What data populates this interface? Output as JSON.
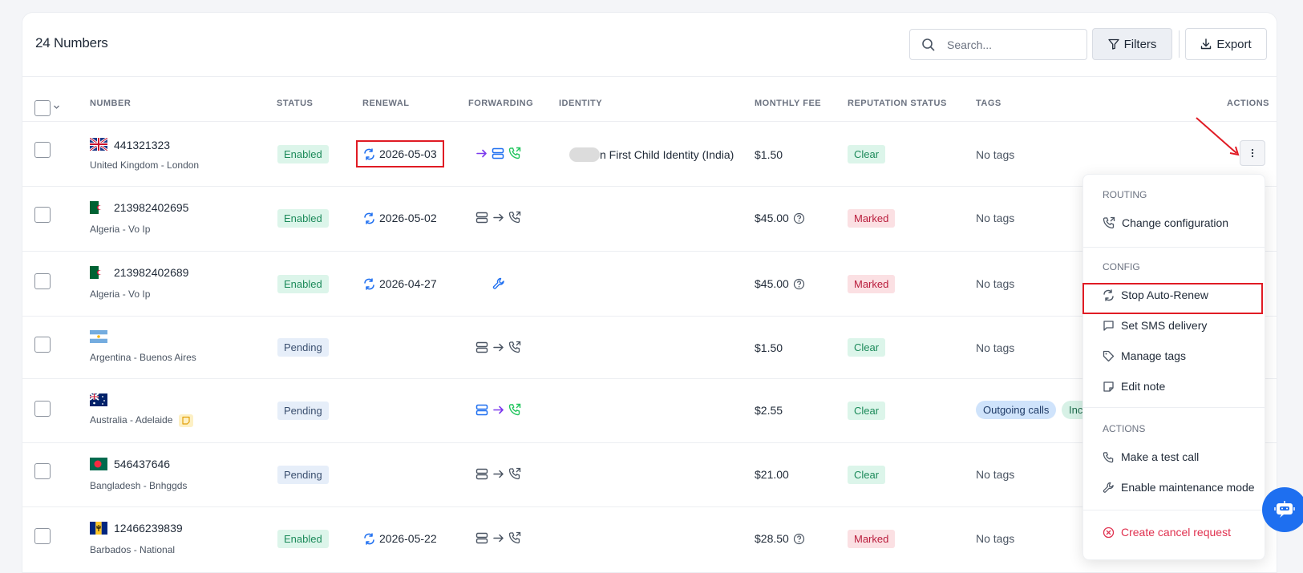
{
  "header": {
    "title": "24 Numbers",
    "search_placeholder": "Search...",
    "filters_label": "Filters",
    "export_label": "Export"
  },
  "table": {
    "columns": [
      "NUMBER",
      "STATUS",
      "RENEWAL",
      "FORWARDING",
      "IDENTITY",
      "MONTHLY FEE",
      "REPUTATION STATUS",
      "TAGS",
      "ACTIONS"
    ],
    "rows": [
      {
        "number": "441321323",
        "location": "United Kingdom - London",
        "status": "Enabled",
        "renewal": "2026-05-03",
        "identity": "n First Child Identity (India)",
        "fee": "$1.50",
        "reputation": "Clear",
        "tags": "No tags"
      },
      {
        "number": "213982402695",
        "location": "Algeria - Vo Ip",
        "status": "Enabled",
        "renewal": "2026-05-02",
        "identity": "",
        "fee": "$45.00",
        "reputation": "Marked",
        "tags": "No tags"
      },
      {
        "number": "213982402689",
        "location": "Algeria - Vo Ip",
        "status": "Enabled",
        "renewal": "2026-04-27",
        "identity": "",
        "fee": "$45.00",
        "reputation": "Marked",
        "tags": "No tags"
      },
      {
        "number": "",
        "location": "Argentina - Buenos Aires",
        "status": "Pending",
        "renewal": "",
        "identity": "",
        "fee": "$1.50",
        "reputation": "Clear",
        "tags": "No tags"
      },
      {
        "number": "",
        "location": "Australia - Adelaide",
        "status": "Pending",
        "renewal": "",
        "identity": "",
        "fee": "$2.55",
        "reputation": "Clear",
        "tags": [
          "Outgoing calls",
          "Inc"
        ]
      },
      {
        "number": "546437646",
        "location": "Bangladesh - Bnhggds",
        "status": "Pending",
        "renewal": "",
        "identity": "",
        "fee": "$21.00",
        "reputation": "Clear",
        "tags": "No tags"
      },
      {
        "number": "12466239839",
        "location": "Barbados - National",
        "status": "Enabled",
        "renewal": "2026-05-22",
        "identity": "",
        "fee": "$28.50",
        "reputation": "Marked",
        "tags": "No tags"
      }
    ]
  },
  "dropdown": {
    "sections": [
      {
        "title": "ROUTING",
        "items": [
          "Change configuration"
        ]
      },
      {
        "title": "CONFIG",
        "items": [
          "Stop Auto-Renew",
          "Set SMS delivery",
          "Manage tags",
          "Edit note"
        ]
      },
      {
        "title": "ACTIONS",
        "items": [
          "Make a test call",
          "Enable maintenance mode"
        ]
      }
    ],
    "cancel": "Create cancel request"
  },
  "colors": {
    "accent": "#1e6ff0",
    "highlight": "#e01b24",
    "enabled_bg": "#dcf5ea",
    "marked_bg": "#fbe0e3"
  }
}
